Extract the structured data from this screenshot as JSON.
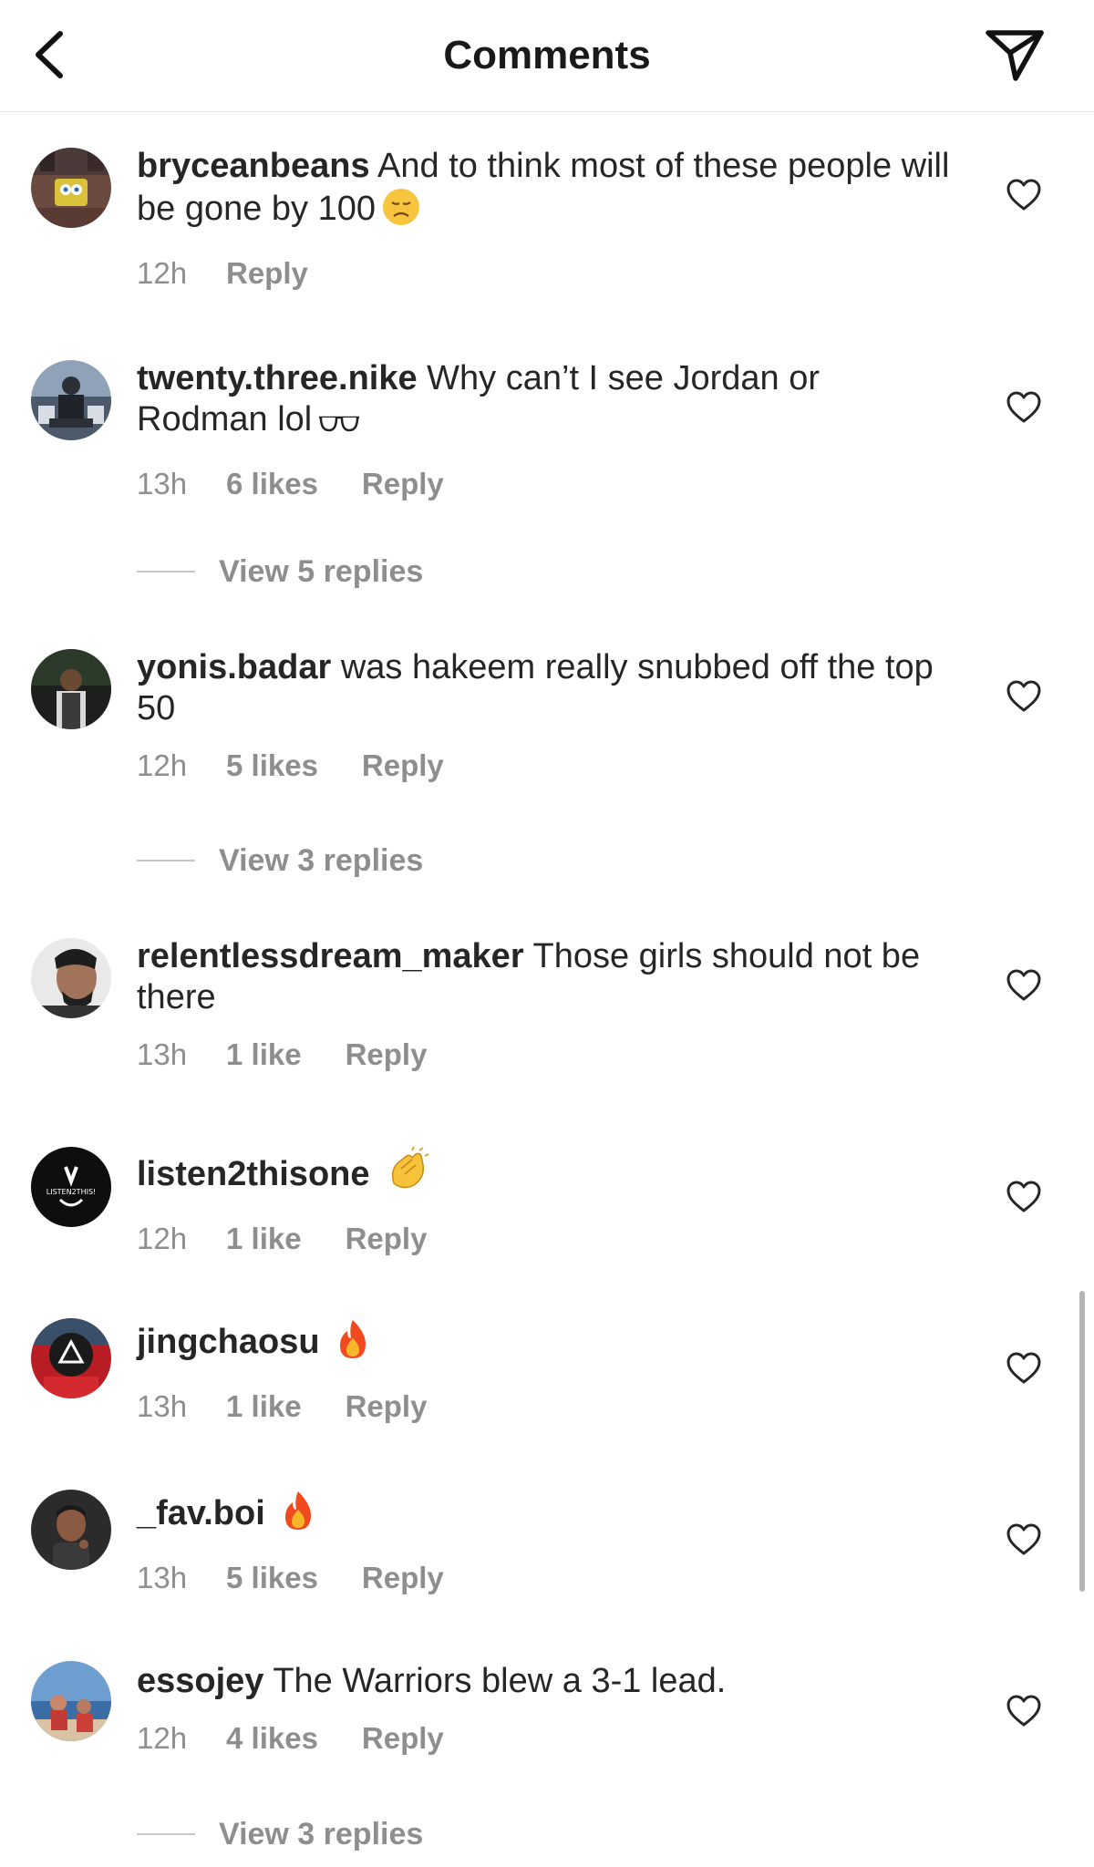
{
  "header": {
    "title": "Comments",
    "back_icon": "chevron-left-icon",
    "send_icon": "paper-plane-icon"
  },
  "colors": {
    "text": "#262626",
    "meta": "#8e8e8e",
    "divider": "#c7c7c7"
  },
  "comments": [
    {
      "username": "bryceanbeans",
      "text": "And to think most of these people will be gone by 100",
      "emoji": "disappointed-face-emoji",
      "time": "12h",
      "likes": "",
      "reply": "Reply"
    },
    {
      "username": "twenty.three.nike",
      "text": "Why can’t I see Jordan or Rodman lol",
      "emoji": "glasses-emoji",
      "time": "13h",
      "likes": "6 likes",
      "reply": "Reply",
      "view_replies": "View 5 replies"
    },
    {
      "username": "yonis.badar",
      "text": "was hakeem really snubbed off the top 50",
      "time": "12h",
      "likes": "5 likes",
      "reply": "Reply",
      "view_replies": "View 3 replies"
    },
    {
      "username": "relentlessdream_maker",
      "text": "Those girls should not be there",
      "time": "13h",
      "likes": "1 like",
      "reply": "Reply"
    },
    {
      "username": "listen2thisone",
      "text": "",
      "emoji": "clapping-hands-emoji",
      "time": "12h",
      "likes": "1 like",
      "reply": "Reply",
      "avatar_text": "LISTEN2THIS!"
    },
    {
      "username": "jingchaosu",
      "text": "",
      "emoji": "fire-emoji",
      "time": "13h",
      "likes": "1 like",
      "reply": "Reply"
    },
    {
      "username": "_fav.boi",
      "text": "",
      "emoji": "fire-emoji",
      "time": "13h",
      "likes": "5 likes",
      "reply": "Reply"
    },
    {
      "username": "essojey",
      "text": "The Warriors blew a 3-1 lead.",
      "time": "12h",
      "likes": "4 likes",
      "reply": "Reply",
      "view_replies": "View 3 replies"
    }
  ]
}
